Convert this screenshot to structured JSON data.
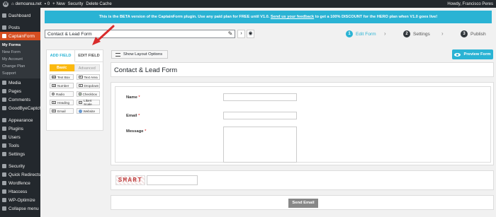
{
  "adminbar": {
    "site": "demoarea.net",
    "comments": "0",
    "new": "New",
    "security": "Security",
    "delete_cache": "Delete Cache",
    "howdy": "Howdy, Francisco Peres"
  },
  "sidebar": {
    "items": [
      {
        "label": "Dashboard",
        "icon": "dashboard-icon"
      },
      {
        "label": "Posts",
        "icon": "pin-icon"
      },
      {
        "label": "CaptainForm",
        "icon": "captainform-icon"
      },
      {
        "label": "Media",
        "icon": "media-icon"
      },
      {
        "label": "Pages",
        "icon": "page-icon"
      },
      {
        "label": "Comments",
        "icon": "comment-icon"
      },
      {
        "label": "GoodByeCaptcha",
        "icon": "shield-icon"
      },
      {
        "label": "Appearance",
        "icon": "brush-icon"
      },
      {
        "label": "Plugins",
        "icon": "plug-icon"
      },
      {
        "label": "Users",
        "icon": "user-icon"
      },
      {
        "label": "Tools",
        "icon": "wrench-icon"
      },
      {
        "label": "Settings",
        "icon": "settings-icon"
      },
      {
        "label": "Security",
        "icon": "lock-icon"
      },
      {
        "label": "Quick Redirects",
        "icon": "redirect-icon"
      },
      {
        "label": "Wordfence",
        "icon": "wordfence-icon"
      },
      {
        "label": "Htaccess",
        "icon": "file-icon"
      },
      {
        "label": "WP-Optimize",
        "icon": "optimize-icon"
      },
      {
        "label": "Collapse menu",
        "icon": "collapse-icon"
      }
    ],
    "submenu": [
      "My Forms",
      "New Form",
      "My Account",
      "Change Plan",
      "Support"
    ]
  },
  "notice": {
    "text_before": "This is the BETA version of the CaptainForm plugin. Use any paid plan for FREE until V1.0. ",
    "link": "Send us your feedback",
    "text_after": " to get a 100% DISCOUNT for the HERO plan when V1.0 goes live!"
  },
  "form_title_value": "Contact & Lead Form",
  "steps": [
    {
      "num": "1",
      "label": "Edit Form"
    },
    {
      "num": "2",
      "label": "Settings"
    },
    {
      "num": "3",
      "label": "Publish"
    }
  ],
  "field_panel": {
    "tabs": [
      "ADD FIELD",
      "EDIT FIELD"
    ],
    "subtabs": [
      "Basic",
      "Advanced"
    ],
    "buttons": [
      "Text Box",
      "Text Area",
      "Number",
      "Dropdown",
      "Radio",
      "Checkbox",
      "Heading",
      "Likert Scale",
      "Email",
      "Website"
    ]
  },
  "layout_options_label": "Show Layout Options",
  "preview_label": "Preview Form",
  "form_heading": "Contact & Lead Form",
  "form_fields": {
    "name_label": "Name",
    "email_label": "Email",
    "message_label": "Message",
    "required_mark": "*"
  },
  "captcha_text": "SMART",
  "send_label": "Send Email",
  "colors": {
    "accent": "#2ab3d4",
    "admin_dark": "#23282d",
    "active_menu": "#d54e21",
    "basic_tab": "#fbb90f"
  }
}
